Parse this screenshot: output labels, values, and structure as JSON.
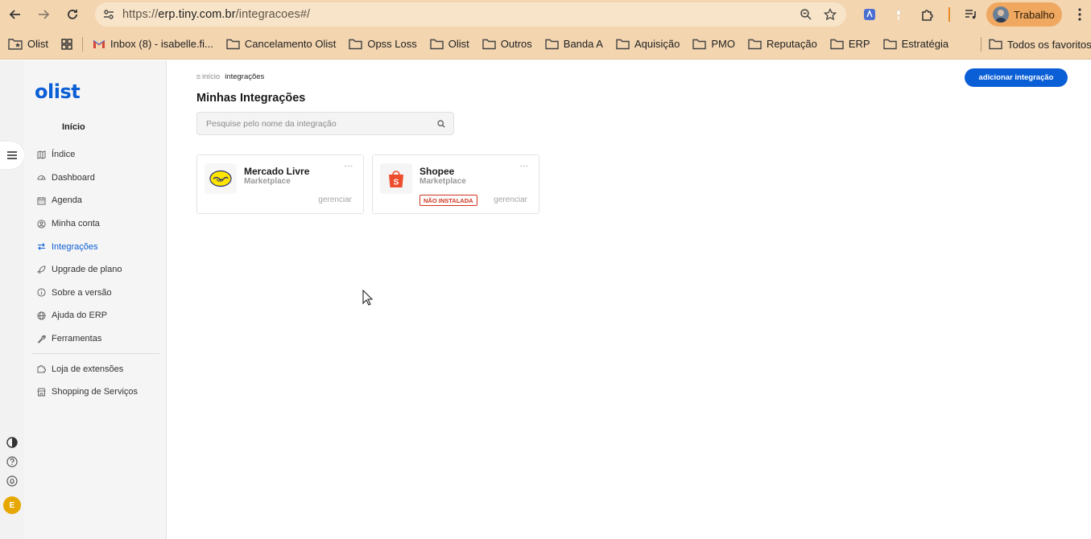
{
  "browser": {
    "url_prefix": "https://",
    "url_host": "erp.tiny.com.br",
    "url_path": "/integracoes#/",
    "profile_label": "Trabalho"
  },
  "bookmarks": {
    "items": [
      {
        "label": "Olist",
        "icon": "folder-star-icon"
      },
      {
        "label": "",
        "icon": "apps-grid-icon"
      },
      {
        "label": "Inbox (8) - isabelle.fi...",
        "icon": "gmail-icon"
      },
      {
        "label": "Cancelamento Olist",
        "icon": "folder-icon"
      },
      {
        "label": "Opss Loss",
        "icon": "folder-icon"
      },
      {
        "label": "Olist",
        "icon": "folder-icon"
      },
      {
        "label": "Outros",
        "icon": "folder-icon"
      },
      {
        "label": "Banda A",
        "icon": "folder-icon"
      },
      {
        "label": "Aquisição",
        "icon": "folder-icon"
      },
      {
        "label": "PMO",
        "icon": "folder-icon"
      },
      {
        "label": "Reputação",
        "icon": "folder-icon"
      },
      {
        "label": "ERP",
        "icon": "folder-icon"
      },
      {
        "label": "Estratégia",
        "icon": "folder-icon"
      }
    ],
    "all_bookmarks": "Todos os favoritos"
  },
  "sidebar": {
    "logo": "olist",
    "title": "Início",
    "items": [
      {
        "label": "Índice",
        "icon": "map-icon",
        "active": false
      },
      {
        "label": "Dashboard",
        "icon": "gauge-icon",
        "active": false
      },
      {
        "label": "Agenda",
        "icon": "calendar-icon",
        "active": false
      },
      {
        "label": "Minha conta",
        "icon": "user-circle-icon",
        "active": false
      },
      {
        "label": "Integrações",
        "icon": "arrows-exchange-icon",
        "active": true
      },
      {
        "label": "Upgrade de plano",
        "icon": "rocket-icon",
        "active": false
      },
      {
        "label": "Sobre a versão",
        "icon": "info-icon",
        "active": false
      },
      {
        "label": "Ajuda do ERP",
        "icon": "help-globe-icon",
        "active": false
      },
      {
        "label": "Ferramentas",
        "icon": "wrench-icon",
        "active": false
      }
    ],
    "extra_items": [
      {
        "label": "Loja de extensões",
        "icon": "puzzle-icon"
      },
      {
        "label": "Shopping de Serviços",
        "icon": "store-icon"
      }
    ],
    "avatar_initial": "E"
  },
  "main": {
    "breadcrumb": {
      "home": "início",
      "current": "integrações"
    },
    "title": "Minhas Integrações",
    "add_button": "adicionar integração",
    "search_placeholder": "Pesquise pelo nome da integração",
    "cards": [
      {
        "name": "Mercado Livre",
        "type": "Marketplace",
        "manage": "gerenciar",
        "badge": "",
        "dots": "···"
      },
      {
        "name": "Shopee",
        "type": "Marketplace",
        "manage": "gerenciar",
        "badge": "NÃO INSTALADA",
        "dots": "···"
      }
    ]
  },
  "colors": {
    "chrome": "#f3d5b0",
    "accent": "#0b5fd6",
    "badge": "#d0331e",
    "shopee": "#ee4d2d",
    "mercado_livre": "#ffe600",
    "avatar": "#e5a700"
  }
}
